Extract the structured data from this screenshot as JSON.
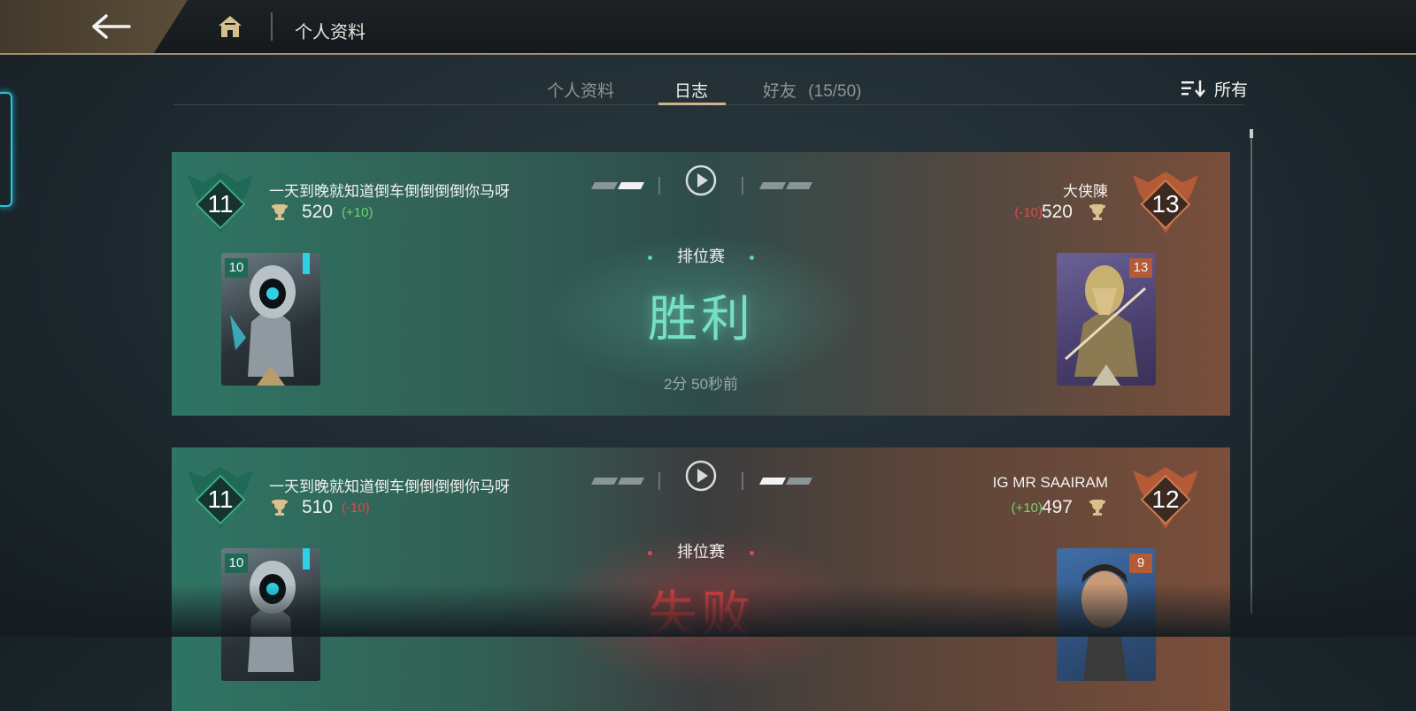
{
  "header": {
    "title": "个人资料",
    "back_icon": "arrow-left-icon",
    "home_icon": "home-icon"
  },
  "tabs": [
    {
      "label": "个人资料",
      "active": false
    },
    {
      "label": "日志",
      "active": true
    },
    {
      "label": "好友",
      "count": "(15/50)",
      "active": false
    }
  ],
  "filter": {
    "label": "所有",
    "icon": "sort-filter-icon"
  },
  "colors": {
    "accent_gold": "#cfb68a",
    "win": "#76e0c2",
    "loss": "#e04444",
    "positive_delta": "#6fd56a",
    "negative_delta": "#e04848"
  },
  "matches": [
    {
      "result": "胜利",
      "outcome": "win",
      "mode": "排位赛",
      "time_ago": "2分 50秒前",
      "left": {
        "name": "一天到晚就知道倒车倒倒倒倒你马呀",
        "level": "11",
        "rating": "520",
        "delta": "(+10)",
        "hero_level": "10"
      },
      "right": {
        "name": "大侠陳",
        "level": "13",
        "rating": "520",
        "delta": "(-10)",
        "hero_level": "13"
      }
    },
    {
      "result": "失败",
      "outcome": "loss",
      "mode": "排位赛",
      "time_ago": "",
      "left": {
        "name": "一天到晚就知道倒车倒倒倒倒你马呀",
        "level": "11",
        "rating": "510",
        "delta": "(-10)",
        "hero_level": "10"
      },
      "right": {
        "name": "IG MR SAAIRAM",
        "level": "12",
        "rating": "497",
        "delta": "(+10)",
        "hero_level": "9"
      }
    }
  ]
}
